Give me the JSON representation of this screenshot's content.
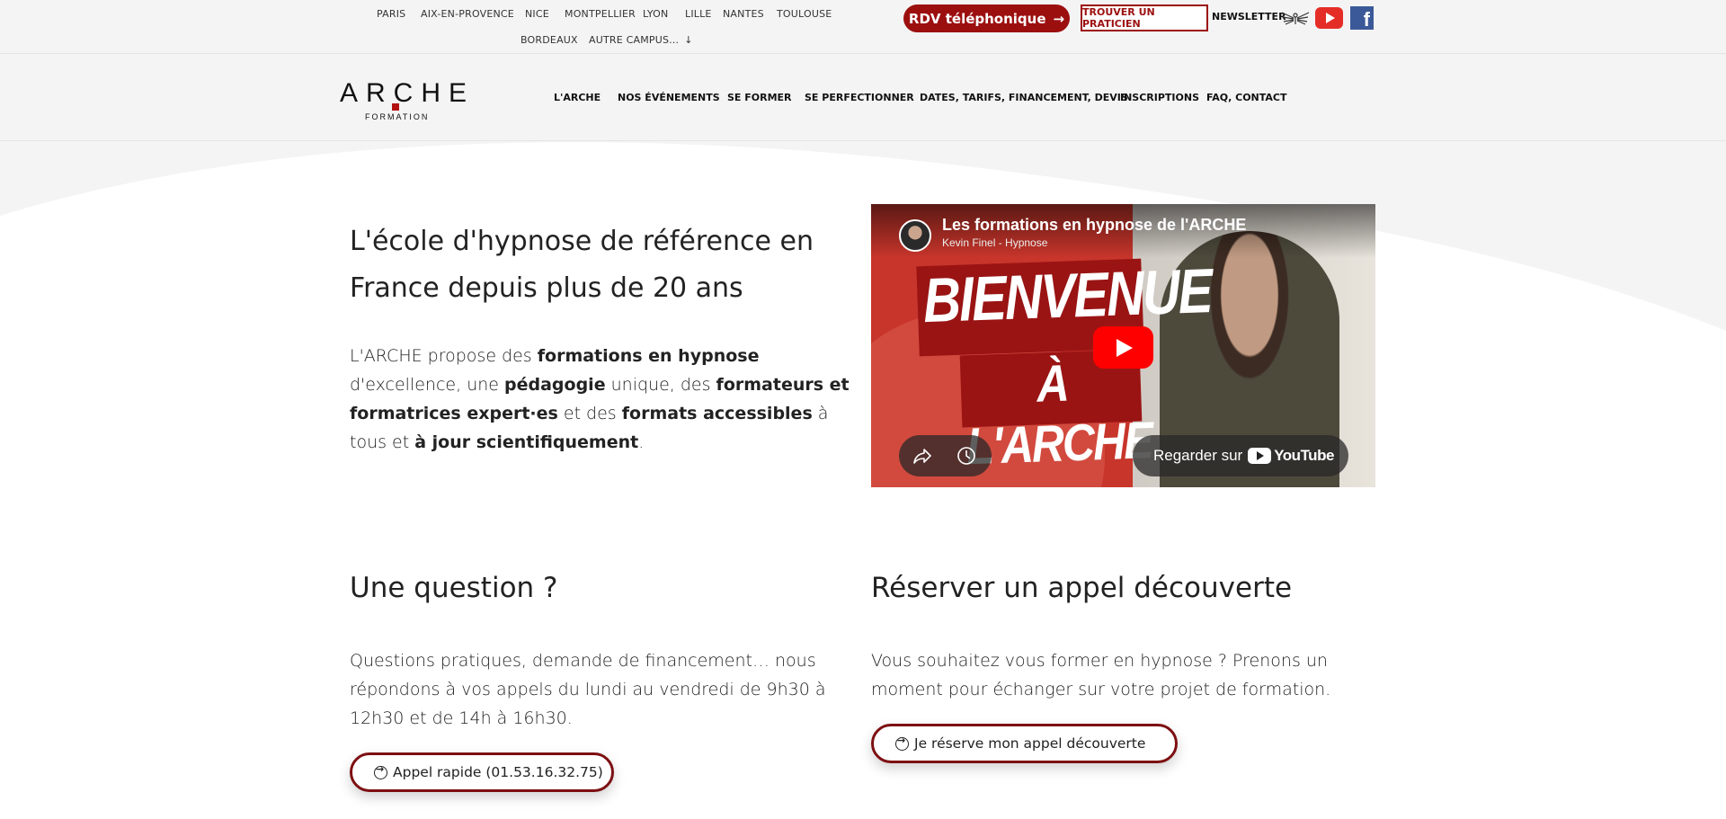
{
  "topbar": {
    "cities_row1": [
      "PARIS",
      "AIX-EN-PROVENCE",
      "NICE",
      "MONTPELLIER",
      "LYON",
      "LILLE",
      "NANTES",
      "TOULOUSE"
    ],
    "cities_row2": [
      "BORDEAUX",
      "AUTRE CAMPUS..."
    ],
    "rdv_label": "RDV téléphonique",
    "rdv_arrow": "→",
    "praticien_label": "TROUVER UN PRATICIEN",
    "newsletter_label": "NEWSLETTER",
    "facebook_glyph": "f"
  },
  "header": {
    "logo_word": "ARCHE",
    "logo_sub": "FORMATION",
    "nav": [
      "L'ARCHE",
      "NOS ÉVÉNEMENTS",
      "SE FORMER",
      "SE PERFECTIONNER",
      "DATES, TARIFS, FINANCEMENT, DEVIS",
      "INSCRIPTIONS",
      "FAQ, CONTACT"
    ]
  },
  "hero": {
    "title": "L'école d'hypnose de référence en France depuis plus de 20 ans",
    "text": [
      {
        "t": "L'ARCHE propose des ",
        "b": false
      },
      {
        "t": "formations en hypnose",
        "b": true
      },
      {
        "t": " d'excellence, une ",
        "b": false
      },
      {
        "t": "pédagogie",
        "b": true
      },
      {
        "t": " unique, des ",
        "b": false
      },
      {
        "t": "formateurs et formatrices expert·es",
        "b": true
      },
      {
        "t": " et des ",
        "b": false
      },
      {
        "t": "formats accessibles",
        "b": true
      },
      {
        "t": " à tous et ",
        "b": false
      },
      {
        "t": "à jour scientifiquement",
        "b": true
      },
      {
        "t": ".",
        "b": false
      }
    ]
  },
  "video": {
    "title": "Les formations en hypnose de l'ARCHE",
    "channel": "Kevin Finel - Hypnose",
    "banner_line1": "BIENVENUE",
    "banner_line2": "À L'ARCHE",
    "watch_on": "Regarder sur",
    "youtube_word": "YouTube"
  },
  "question": {
    "title": "Une question ?",
    "text": "Questions pratiques, demande de financement… nous répondons à vos appels du lundi au vendredi de 9h30 à 12h30 et de 14h à 16h30.",
    "button": "Appel rapide (01.53.16.32.75)"
  },
  "appel": {
    "title": "Réserver un appel découverte",
    "text": "Vous souhaitez vous former en hypnose ? Prenons un moment pour échanger sur votre projet de formation.",
    "button": "Je réserve mon appel découverte"
  },
  "colors": {
    "brand_red": "#9c0f0f",
    "button_border": "#7d0f12",
    "background": "#f4f4f4",
    "youtube_red": "#ff0000",
    "facebook_blue": "#3b5998"
  },
  "icons": [
    "arrow-down-icon",
    "wings-icon",
    "youtube-icon",
    "facebook-icon",
    "play-icon",
    "share-icon",
    "clock-icon",
    "circle-arrow-icon"
  ]
}
